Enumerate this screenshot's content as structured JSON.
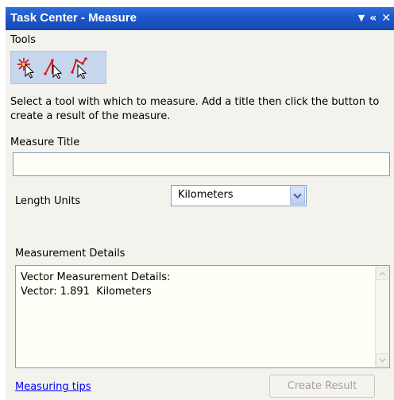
{
  "window": {
    "title": "Task Center - Measure",
    "controls": {
      "menu": "▼",
      "collapse": "«",
      "close": "✕"
    }
  },
  "tools": {
    "label": "Tools",
    "items": [
      {
        "name": "select-tool",
        "icon": "sparkle-cursor-icon"
      },
      {
        "name": "vector-tool",
        "icon": "vector-cursor-icon"
      },
      {
        "name": "polyline-tool",
        "icon": "polyline-cursor-icon"
      }
    ]
  },
  "instructions": "Select a tool with which to measure. Add a title then click the button to create a result of the measure.",
  "measure_title": {
    "label": "Measure Title",
    "value": "",
    "placeholder": ""
  },
  "length_units": {
    "label": "Length Units",
    "selected": "Kilometers"
  },
  "details": {
    "label": "Measurement Details",
    "text": "Vector Measurement Details:\nVector: 1.891  Kilometers"
  },
  "footer": {
    "tips_link": "Measuring tips",
    "create_button": "Create Result"
  },
  "colors": {
    "titlebar": "#1c57c9",
    "panel": "#f3f2ec",
    "link": "#0000ff",
    "accent_red": "#cc1111"
  }
}
